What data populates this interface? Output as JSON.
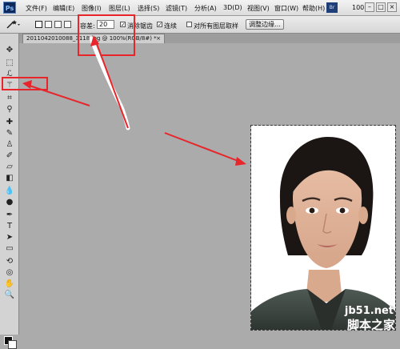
{
  "menubar": {
    "logo": "Ps",
    "items": [
      {
        "label": "文件(F)"
      },
      {
        "label": "编辑(E)"
      },
      {
        "label": "图像(I)"
      },
      {
        "label": "图层(L)"
      },
      {
        "label": "选择(S)"
      },
      {
        "label": "滤镜(T)"
      },
      {
        "label": "分析(A)"
      },
      {
        "label": "3D(D)"
      },
      {
        "label": "视图(V)"
      },
      {
        "label": "窗口(W)"
      },
      {
        "label": "帮助(H)"
      }
    ],
    "bridge_label": "Br",
    "zoom": "100"
  },
  "options": {
    "tolerance_label": "容差:",
    "tolerance_value": "20",
    "antialias_label": "消除锯齿",
    "contiguous_label": "连续",
    "sample_all_label": "对所有图层取样",
    "refine_edge_label": "调整边缘..."
  },
  "document": {
    "tab_title": "2011042010088_3118.jpg @ 100%(RGB/8#) *",
    "tab_close": "×"
  },
  "watermark": {
    "line1": "jb51.net",
    "line2": "脚本之家"
  },
  "colors": {
    "annotation": "#e8252b",
    "workspace": "#ababab"
  }
}
